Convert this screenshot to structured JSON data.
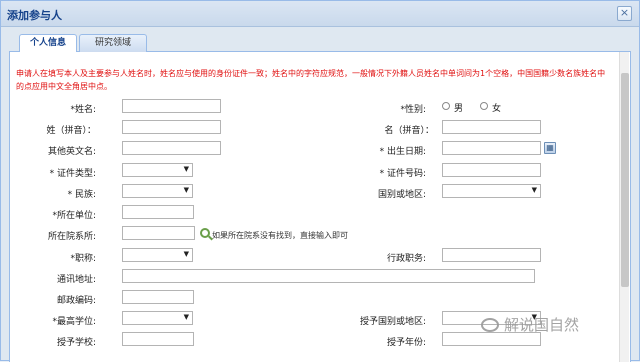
{
  "window": {
    "title": "添加参与人",
    "close": "×"
  },
  "tabs": [
    {
      "label": "个人信息"
    },
    {
      "label": "研究领域"
    }
  ],
  "notice": "申请人在填写本人及主要参与人姓名时，姓名应与使用的身份证件一致；姓名中的字符应规范，一般情况下外籍人员姓名中单词间为1个空格，中国国籍少数名族姓名中的点应用中文全角居中点。",
  "form": {
    "name": "*姓名:",
    "gender": "*性别:",
    "male": "男",
    "female": "女",
    "surname_pinyin": "姓（拼音）：",
    "given_pinyin": "名（拼音）：",
    "other_english": "其他英文名:",
    "birthdate": "* 出生日期:",
    "id_type": "* 证件类型:",
    "id_number": "* 证件号码:",
    "ethnicity": "* 民族:",
    "country": "国别或地区:",
    "unit": "*所在单位:",
    "department": "所在院系所:",
    "department_hint": "如果所在院系没有找到，直接输入即可",
    "title": "*职称:",
    "admin_post": "行政职务:",
    "address": "通讯地址:",
    "postcode": "邮政编码:",
    "degree": "*最高学位:",
    "degree_country": "授予国别或地区:",
    "school": "授予学校:",
    "degree_year": "授予年份:"
  },
  "watermark": "解说国自然"
}
